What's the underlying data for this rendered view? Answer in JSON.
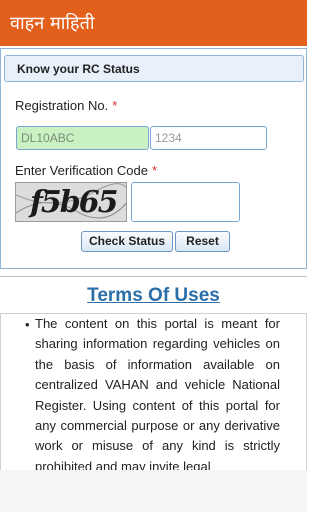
{
  "app_bar": {
    "title": "वाहन माहिती",
    "color": "#e35f1c"
  },
  "rc_status": {
    "header": "Know your RC Status",
    "registration": {
      "label": "Registration No.",
      "required_mark": "*",
      "state_value": "DL10ABC",
      "number_placeholder": "1234"
    },
    "verification": {
      "label": "Enter Verification Code",
      "required_mark": "*",
      "captcha_text": "f5b65",
      "code_value": ""
    },
    "buttons": {
      "check_status": "Check Status",
      "reset": "Reset"
    }
  },
  "terms": {
    "title": "Terms Of Uses",
    "bullet": "•",
    "text": "The content on this portal is meant for sharing information regarding vehicles on the basis of information available on centralized VAHAN and vehicle National Register. Using content of this portal for any commercial purpose or any derivative work or misuse of any kind is strictly prohibited and may invite legal"
  }
}
